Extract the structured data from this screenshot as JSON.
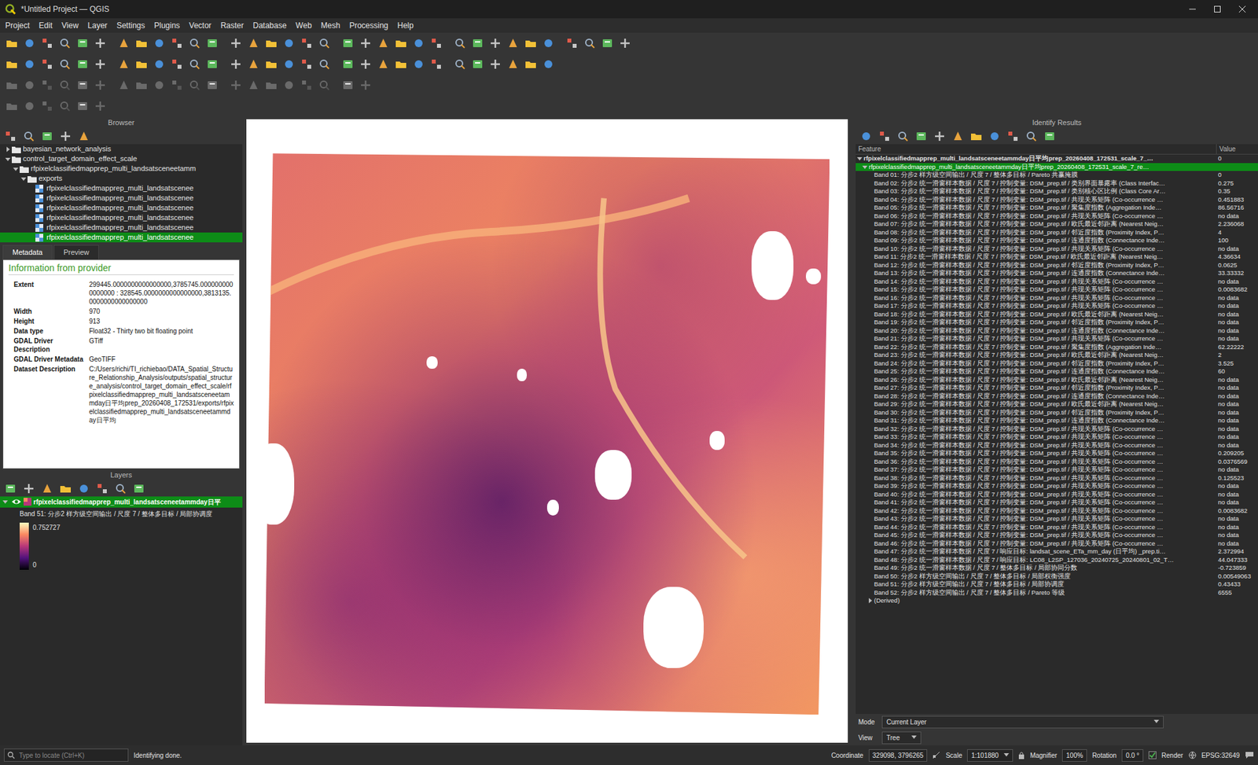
{
  "window": {
    "title": "*Untitled Project — QGIS"
  },
  "menu": [
    "Project",
    "Edit",
    "View",
    "Layer",
    "Settings",
    "Plugins",
    "Vector",
    "Raster",
    "Database",
    "Web",
    "Mesh",
    "Processing",
    "Help"
  ],
  "browser": {
    "title": "Browser",
    "items": [
      {
        "label": "bayesian_network_analysis",
        "kind": "folder",
        "expanded": false,
        "selected": false,
        "children": []
      },
      {
        "label": "control_target_domain_effect_scale",
        "kind": "folder",
        "expanded": true,
        "selected": false,
        "children": [
          {
            "label": "rfpixelclassifiedmapprep_multi_landsatsceneetamm",
            "kind": "folder",
            "expanded": true,
            "selected": false,
            "children": [
              {
                "label": "exports",
                "kind": "folder",
                "expanded": true,
                "selected": false,
                "children": [
                  {
                    "label": "rfpixelclassifiedmapprep_multi_landsatscenee",
                    "kind": "raster",
                    "selected": false,
                    "children": []
                  },
                  {
                    "label": "rfpixelclassifiedmapprep_multi_landsatscenee",
                    "kind": "raster",
                    "selected": false,
                    "children": []
                  },
                  {
                    "label": "rfpixelclassifiedmapprep_multi_landsatscenee",
                    "kind": "raster",
                    "selected": false,
                    "children": []
                  },
                  {
                    "label": "rfpixelclassifiedmapprep_multi_landsatscenee",
                    "kind": "raster",
                    "selected": false,
                    "children": []
                  },
                  {
                    "label": "rfpixelclassifiedmapprep_multi_landsatscenee",
                    "kind": "raster",
                    "selected": false,
                    "children": []
                  },
                  {
                    "label": "rfpixelclassifiedmapprep_multi_landsatscenee",
                    "kind": "raster",
                    "selected": true,
                    "children": []
                  }
                ]
              }
            ]
          }
        ]
      }
    ]
  },
  "metadata": {
    "tabs": [
      {
        "label": "Metadata",
        "selected": true
      },
      {
        "label": "Preview",
        "selected": false
      }
    ],
    "heading": "Information from provider",
    "rows": [
      {
        "key": "Extent",
        "value": "299445.0000000000000000,3785745.0000000000000000 : 328545.0000000000000000,3813135.0000000000000000"
      },
      {
        "key": "Width",
        "value": "970"
      },
      {
        "key": "Height",
        "value": "913"
      },
      {
        "key": "Data type",
        "value": "Float32 - Thirty two bit floating point"
      },
      {
        "key": "GDAL Driver Description",
        "value": "GTiff"
      },
      {
        "key": "GDAL Driver Metadata",
        "value": "GeoTIFF"
      },
      {
        "key": "Dataset Description",
        "value": "C:/Users/richi/TI_richiebao/DATA_Spatial_Structure_Relationship_Analysis/outputs/spatial_structure_analysis/control_target_domain_effect_scale/rfpixelclassifiedmapprep_multi_landsatsceneetammday日平均prep_20260408_172531/exports/rfpixelclassifiedmapprep_multi_landsatsceneetammday日平均"
      }
    ]
  },
  "layers": {
    "title": "Layers",
    "layer": {
      "label": "rfpixelclassifiedmapprep_multi_landsatsceneetammday日平",
      "visible": true,
      "expanded": true,
      "selected": true
    },
    "band_label": "Band 51: 分步2 样方级空间输出 / 尺度 7 / 整体多目标 / 局部协调度",
    "legend": {
      "max": "0.752727",
      "min": "0"
    }
  },
  "identify": {
    "title": "Identify Results",
    "columns": [
      "Feature",
      "Value"
    ],
    "feature": {
      "label": "rfpixelclassifiedmapprep_multi_landsatsceneetammday日平均prep_20260408_172531_scale_7_…",
      "value": "0",
      "expanded": true
    },
    "layer_row": {
      "label": "rfpixelclassifiedmapprep_multi_landsatsceneetammday日平均prep_20260408_172531_scale_7_re…",
      "expanded": true,
      "selected": true
    },
    "bands": [
      {
        "label": "Band 01: 分步2 样方级空间输出 / 尺度 7 / 整体多目标 / Pareto 共赢掩膜",
        "value": "0"
      },
      {
        "label": "Band 02: 分步2 统一滑窗样本数据 / 尺度 7 / 控制变量: DSM_prep.tif / 类别界面暴露率 (Class Interfac…",
        "value": "0.275"
      },
      {
        "label": "Band 03: 分步2 统一滑窗样本数据 / 尺度 7 / 控制变量: DSM_prep.tif / 类别核心区比例 (Class Core Ar…",
        "value": "0.35"
      },
      {
        "label": "Band 04: 分步2 统一滑窗样本数据 / 尺度 7 / 控制变量: DSM_prep.tif / 共现关系矩阵 (Co-occurrence …",
        "value": "0.451883"
      },
      {
        "label": "Band 05: 分步2 统一滑窗样本数据 / 尺度 7 / 控制变量: DSM_prep.tif / 聚集度指数 (Aggregation Inde…",
        "value": "86.56716"
      },
      {
        "label": "Band 06: 分步2 统一滑窗样本数据 / 尺度 7 / 控制变量: DSM_prep.tif / 共现关系矩阵 (Co-occurrence …",
        "value": "no data"
      },
      {
        "label": "Band 07: 分步2 统一滑窗样本数据 / 尺度 7 / 控制变量: DSM_prep.tif / 欧氏最近邻距离 (Nearest Neig…",
        "value": "2.236068"
      },
      {
        "label": "Band 08: 分步2 统一滑窗样本数据 / 尺度 7 / 控制变量: DSM_prep.tif / 邻近度指数 (Proximity Index, P…",
        "value": "4"
      },
      {
        "label": "Band 09: 分步2 统一滑窗样本数据 / 尺度 7 / 控制变量: DSM_prep.tif / 连通度指数 (Connectance Inde…",
        "value": "100"
      },
      {
        "label": "Band 10: 分步2 统一滑窗样本数据 / 尺度 7 / 控制变量: DSM_prep.tif / 共现关系矩阵 (Co-occurrence …",
        "value": "no data"
      },
      {
        "label": "Band 11: 分步2 统一滑窗样本数据 / 尺度 7 / 控制变量: DSM_prep.tif / 欧氏最近邻距离 (Nearest Neig…",
        "value": "4.36634"
      },
      {
        "label": "Band 12: 分步2 统一滑窗样本数据 / 尺度 7 / 控制变量: DSM_prep.tif / 邻近度指数 (Proximity Index, P…",
        "value": "0.0625"
      },
      {
        "label": "Band 13: 分步2 统一滑窗样本数据 / 尺度 7 / 控制变量: DSM_prep.tif / 连通度指数 (Connectance Inde…",
        "value": "33.33332"
      },
      {
        "label": "Band 14: 分步2 统一滑窗样本数据 / 尺度 7 / 控制变量: DSM_prep.tif / 共现关系矩阵 (Co-occurrence …",
        "value": "no data"
      },
      {
        "label": "Band 15: 分步2 统一滑窗样本数据 / 尺度 7 / 控制变量: DSM_prep.tif / 共现关系矩阵 (Co-occurrence …",
        "value": "0.0083682"
      },
      {
        "label": "Band 16: 分步2 统一滑窗样本数据 / 尺度 7 / 控制变量: DSM_prep.tif / 共现关系矩阵 (Co-occurrence …",
        "value": "no data"
      },
      {
        "label": "Band 17: 分步2 统一滑窗样本数据 / 尺度 7 / 控制变量: DSM_prep.tif / 共现关系矩阵 (Co-occurrence …",
        "value": "no data"
      },
      {
        "label": "Band 18: 分步2 统一滑窗样本数据 / 尺度 7 / 控制变量: DSM_prep.tif / 欧氏最近邻距离 (Nearest Neig…",
        "value": "no data"
      },
      {
        "label": "Band 19: 分步2 统一滑窗样本数据 / 尺度 7 / 控制变量: DSM_prep.tif / 邻近度指数 (Proximity Index, P…",
        "value": "no data"
      },
      {
        "label": "Band 20: 分步2 统一滑窗样本数据 / 尺度 7 / 控制变量: DSM_prep.tif / 连通度指数 (Connectance Inde…",
        "value": "no data"
      },
      {
        "label": "Band 21: 分步2 统一滑窗样本数据 / 尺度 7 / 控制变量: DSM_prep.tif / 共现关系矩阵 (Co-occurrence …",
        "value": "no data"
      },
      {
        "label": "Band 22: 分步2 统一滑窗样本数据 / 尺度 7 / 控制变量: DSM_prep.tif / 聚集度指数 (Aggregation Inde…",
        "value": "62.22222"
      },
      {
        "label": "Band 23: 分步2 统一滑窗样本数据 / 尺度 7 / 控制变量: DSM_prep.tif / 欧氏最近邻距离 (Nearest Neig…",
        "value": "2"
      },
      {
        "label": "Band 24: 分步2 统一滑窗样本数据 / 尺度 7 / 控制变量: DSM_prep.tif / 邻近度指数 (Proximity Index, P…",
        "value": "3.525"
      },
      {
        "label": "Band 25: 分步2 统一滑窗样本数据 / 尺度 7 / 控制变量: DSM_prep.tif / 连通度指数 (Connectance Inde…",
        "value": "60"
      },
      {
        "label": "Band 26: 分步2 统一滑窗样本数据 / 尺度 7 / 控制变量: DSM_prep.tif / 欧氏最近邻距离 (Nearest Neig…",
        "value": "no data"
      },
      {
        "label": "Band 27: 分步2 统一滑窗样本数据 / 尺度 7 / 控制变量: DSM_prep.tif / 邻近度指数 (Proximity Index, P…",
        "value": "no data"
      },
      {
        "label": "Band 28: 分步2 统一滑窗样本数据 / 尺度 7 / 控制变量: DSM_prep.tif / 连通度指数 (Connectance Inde…",
        "value": "no data"
      },
      {
        "label": "Band 29: 分步2 统一滑窗样本数据 / 尺度 7 / 控制变量: DSM_prep.tif / 欧氏最近邻距离 (Nearest Neig…",
        "value": "no data"
      },
      {
        "label": "Band 30: 分步2 统一滑窗样本数据 / 尺度 7 / 控制变量: DSM_prep.tif / 邻近度指数 (Proximity Index, P…",
        "value": "no data"
      },
      {
        "label": "Band 31: 分步2 统一滑窗样本数据 / 尺度 7 / 控制变量: DSM_prep.tif / 连通度指数 (Connectance Inde…",
        "value": "no data"
      },
      {
        "label": "Band 32: 分步2 统一滑窗样本数据 / 尺度 7 / 控制变量: DSM_prep.tif / 共现关系矩阵 (Co-occurrence …",
        "value": "no data"
      },
      {
        "label": "Band 33: 分步2 统一滑窗样本数据 / 尺度 7 / 控制变量: DSM_prep.tif / 共现关系矩阵 (Co-occurrence …",
        "value": "no data"
      },
      {
        "label": "Band 34: 分步2 统一滑窗样本数据 / 尺度 7 / 控制变量: DSM_prep.tif / 共现关系矩阵 (Co-occurrence …",
        "value": "no data"
      },
      {
        "label": "Band 35: 分步2 统一滑窗样本数据 / 尺度 7 / 控制变量: DSM_prep.tif / 共现关系矩阵 (Co-occurrence …",
        "value": "0.209205"
      },
      {
        "label": "Band 36: 分步2 统一滑窗样本数据 / 尺度 7 / 控制变量: DSM_prep.tif / 共现关系矩阵 (Co-occurrence …",
        "value": "0.0376569"
      },
      {
        "label": "Band 37: 分步2 统一滑窗样本数据 / 尺度 7 / 控制变量: DSM_prep.tif / 共现关系矩阵 (Co-occurrence …",
        "value": "no data"
      },
      {
        "label": "Band 38: 分步2 统一滑窗样本数据 / 尺度 7 / 控制变量: DSM_prep.tif / 共现关系矩阵 (Co-occurrence …",
        "value": "0.125523"
      },
      {
        "label": "Band 39: 分步2 统一滑窗样本数据 / 尺度 7 / 控制变量: DSM_prep.tif / 共现关系矩阵 (Co-occurrence …",
        "value": "no data"
      },
      {
        "label": "Band 40: 分步2 统一滑窗样本数据 / 尺度 7 / 控制变量: DSM_prep.tif / 共现关系矩阵 (Co-occurrence …",
        "value": "no data"
      },
      {
        "label": "Band 41: 分步2 统一滑窗样本数据 / 尺度 7 / 控制变量: DSM_prep.tif / 共现关系矩阵 (Co-occurrence …",
        "value": "no data"
      },
      {
        "label": "Band 42: 分步2 统一滑窗样本数据 / 尺度 7 / 控制变量: DSM_prep.tif / 共现关系矩阵 (Co-occurrence …",
        "value": "0.0083682"
      },
      {
        "label": "Band 43: 分步2 统一滑窗样本数据 / 尺度 7 / 控制变量: DSM_prep.tif / 共现关系矩阵 (Co-occurrence …",
        "value": "no data"
      },
      {
        "label": "Band 44: 分步2 统一滑窗样本数据 / 尺度 7 / 控制变量: DSM_prep.tif / 共现关系矩阵 (Co-occurrence …",
        "value": "no data"
      },
      {
        "label": "Band 45: 分步2 统一滑窗样本数据 / 尺度 7 / 控制变量: DSM_prep.tif / 共现关系矩阵 (Co-occurrence …",
        "value": "no data"
      },
      {
        "label": "Band 46: 分步2 统一滑窗样本数据 / 尺度 7 / 控制变量: DSM_prep.tif / 共现关系矩阵 (Co-occurrence …",
        "value": "no data"
      },
      {
        "label": "Band 47: 分步2 统一滑窗样本数据 / 尺度 7 / 响应目标: landsat_scene_ETa_mm_day (日平均) _prep.ti…",
        "value": "2.372994"
      },
      {
        "label": "Band 48: 分步2 统一滑窗样本数据 / 尺度 7 / 响应目标: LC08_L2SP_127036_20240725_20240801_02_T…",
        "value": "44.047333"
      },
      {
        "label": "Band 49: 分步2 统一滑窗样本数据 / 尺度 7 / 整体多目标 / 局部协同分数",
        "value": "-0.723859"
      },
      {
        "label": "Band 50: 分步2 样方级空间输出 / 尺度 7 / 整体多目标 / 局部权衡强度",
        "value": "0.00549063"
      },
      {
        "label": "Band 51: 分步2 样方级空间输出 / 尺度 7 / 整体多目标 / 局部协调度",
        "value": "0.43433"
      },
      {
        "label": "Band 52: 分步2 样方级空间输出 / 尺度 7 / 整体多目标 / Pareto 等级",
        "value": "6555"
      }
    ],
    "derived": {
      "label": "(Derived)",
      "expanded": false
    },
    "mode": {
      "label": "Mode",
      "value": "Current Layer"
    },
    "view": {
      "label": "View",
      "value": "Tree"
    }
  },
  "status_bar": {
    "search_placeholder": "Type to locate (Ctrl+K)",
    "message": "Identifying done.",
    "coordinate_label": "Coordinate",
    "coordinate": "329098, 3796265",
    "scale_label": "Scale",
    "scale": "1:101880",
    "magnifier_label": "Magnifier",
    "magnifier": "100%",
    "rotation_label": "Rotation",
    "rotation": "0.0 °",
    "render_label": "Render",
    "render_checked": true,
    "crs": "EPSG:32649"
  }
}
